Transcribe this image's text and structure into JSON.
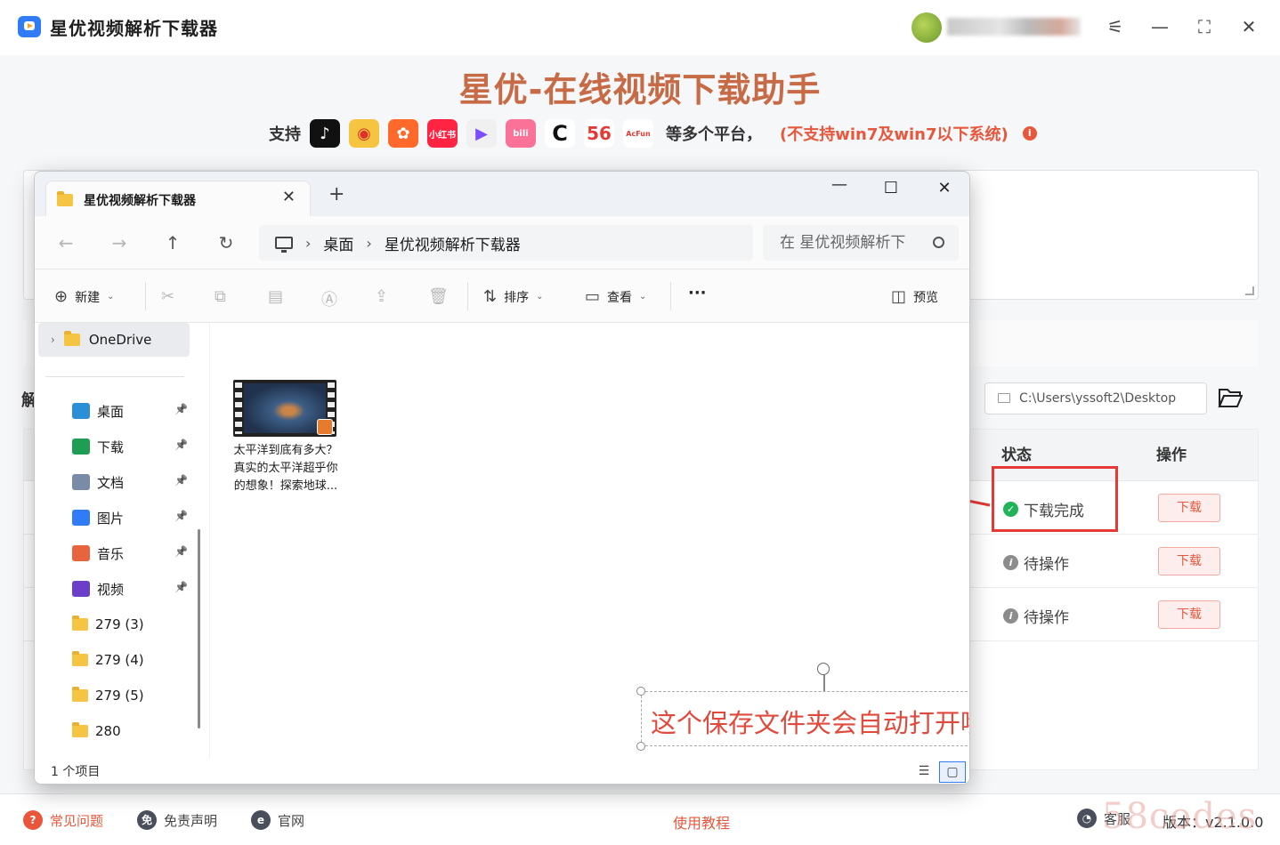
{
  "app": {
    "title": "星优视频解析下载器",
    "hero": "星优-在线视频下载助手",
    "support_label": "支持",
    "platforms": [
      {
        "name": "douyin",
        "text": "♪",
        "color": "#111111"
      },
      {
        "name": "weibo",
        "text": "◉",
        "color": "#f5c542"
      },
      {
        "name": "kuaishou",
        "text": "✿",
        "color": "#ff6a2c"
      },
      {
        "name": "xiaohongshu",
        "text": "小红书",
        "color": "#ff2442"
      },
      {
        "name": "haokan",
        "text": "▶",
        "color": "#f0f0f0"
      },
      {
        "name": "bilibili",
        "text": "bili",
        "color": "#fb7299"
      },
      {
        "name": "c-logo",
        "text": "C",
        "color": "#ffffff"
      },
      {
        "name": "56",
        "text": "56",
        "color": "#ffffff"
      },
      {
        "name": "acfun",
        "text": "AcFun",
        "color": "#ffffff"
      }
    ],
    "platforms_more": "等多个平台，",
    "warning": "(不支持win7及win7以下系统)",
    "section_label": "解",
    "save_path": "C:\\Users\\yssoft2\\Desktop",
    "table": {
      "col_status": "状态",
      "col_action": "操作",
      "rows": [
        {
          "status": "下载完成",
          "state": "done",
          "action": "下载"
        },
        {
          "status": "待操作",
          "state": "pending",
          "action": "下载"
        },
        {
          "status": "待操作",
          "state": "pending",
          "action": "下载"
        }
      ]
    },
    "footer": {
      "faq": "常见问题",
      "disclaimer": "免责声明",
      "website": "官网",
      "tutorial": "使用教程",
      "service": "客服",
      "version": "版本：v2.1.0.0"
    },
    "watermark": "58codes"
  },
  "explorer": {
    "tab_title": "星优视频解析下载器",
    "breadcrumb": [
      "桌面",
      "星优视频解析下载器"
    ],
    "search_placeholder": "在 星优视频解析下",
    "toolbar": {
      "new": "新建",
      "sort": "排序",
      "view": "查看",
      "more": "···",
      "preview": "预览"
    },
    "sidebar": {
      "onedrive": "OneDrive",
      "quick": [
        {
          "label": "桌面",
          "icon": "desktop-icon",
          "color": "#2b8fd6",
          "pinned": true
        },
        {
          "label": "下载",
          "icon": "download-icon",
          "color": "#1f9d55",
          "pinned": true
        },
        {
          "label": "文档",
          "icon": "document-icon",
          "color": "#7a8ba8",
          "pinned": true
        },
        {
          "label": "图片",
          "icon": "pictures-icon",
          "color": "#2f7cf6",
          "pinned": true
        },
        {
          "label": "音乐",
          "icon": "music-icon",
          "color": "#e8643c",
          "pinned": true
        },
        {
          "label": "视频",
          "icon": "video-icon",
          "color": "#6b3fc9",
          "pinned": true
        },
        {
          "label": "279 (3)",
          "icon": "folder-icon",
          "color": "#f6c443",
          "pinned": false
        },
        {
          "label": "279 (4)",
          "icon": "folder-icon",
          "color": "#f6c443",
          "pinned": false
        },
        {
          "label": "279 (5)",
          "icon": "folder-icon",
          "color": "#f6c443",
          "pinned": false
        },
        {
          "label": "280",
          "icon": "folder-icon",
          "color": "#f6c443",
          "pinned": false
        }
      ]
    },
    "file": {
      "name": "太平洋到底有多大？真实的太平洋超乎你的想象！探索地球..."
    },
    "annotation": "这个保存文件夹会自动打开哦",
    "status_count": "1 个项目"
  }
}
